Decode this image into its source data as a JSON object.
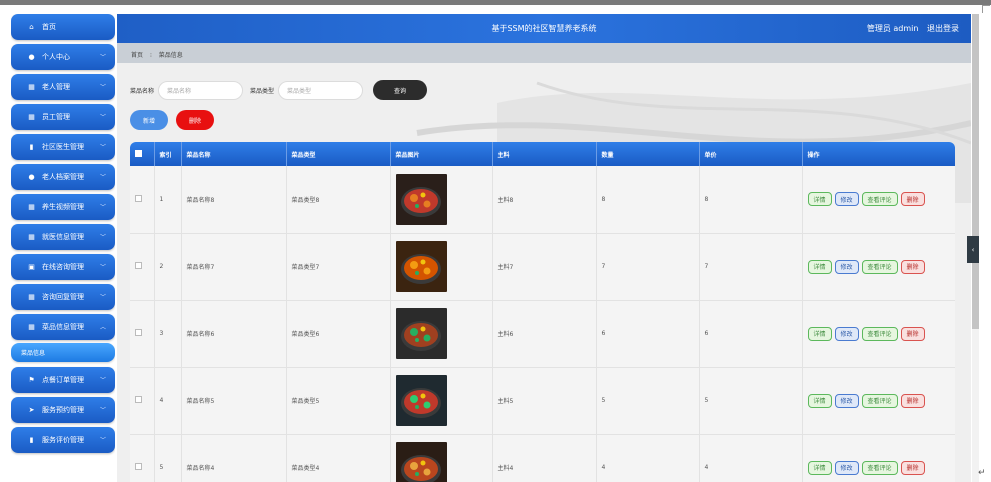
{
  "app": {
    "title": "基于SSM的社区智慧养老系统",
    "user_label": "管理员 admin",
    "logout_label": "退出登录"
  },
  "sidebar": {
    "items": [
      {
        "label": "首页",
        "icon": "home-icon",
        "glyph": "⌂",
        "has_chevron": false
      },
      {
        "label": "个人中心",
        "icon": "user-icon",
        "glyph": "●",
        "has_chevron": true
      },
      {
        "label": "老人管理",
        "icon": "grid-icon",
        "glyph": "▦",
        "has_chevron": true
      },
      {
        "label": "员工管理",
        "icon": "grid-icon",
        "glyph": "▦",
        "has_chevron": true
      },
      {
        "label": "社区医生管理",
        "icon": "chart-icon",
        "glyph": "▮",
        "has_chevron": true
      },
      {
        "label": "老人档案管理",
        "icon": "user-icon",
        "glyph": "●",
        "has_chevron": true
      },
      {
        "label": "养生视频管理",
        "icon": "grid-icon",
        "glyph": "▦",
        "has_chevron": true
      },
      {
        "label": "就医信息管理",
        "icon": "grid-icon",
        "glyph": "▦",
        "has_chevron": true
      },
      {
        "label": "在线咨询管理",
        "icon": "clipboard-icon",
        "glyph": "▣",
        "has_chevron": true
      },
      {
        "label": "咨询回复管理",
        "icon": "grid-icon",
        "glyph": "▦",
        "has_chevron": true
      },
      {
        "label": "菜品信息管理",
        "icon": "grid-icon",
        "glyph": "▦",
        "has_chevron": true,
        "expanded": true
      },
      {
        "label": "点餐订单管理",
        "icon": "flag-icon",
        "glyph": "⚑",
        "has_chevron": true
      },
      {
        "label": "服务预约管理",
        "icon": "send-icon",
        "glyph": "➤",
        "has_chevron": true
      },
      {
        "label": "服务评价管理",
        "icon": "bar-chart-icon",
        "glyph": "▮",
        "has_chevron": true
      }
    ],
    "active_sub_item": "菜品信息"
  },
  "breadcrumb": {
    "home": "首页",
    "separator": "⁝",
    "current": "菜品信息"
  },
  "search": {
    "name_label": "菜品名称",
    "name_placeholder": "菜品名称",
    "type_label": "菜品类型",
    "type_placeholder": "菜品类型",
    "query_button": "查询"
  },
  "actions": {
    "add_button": "新增",
    "delete_button": "删除"
  },
  "table": {
    "columns": [
      "索引",
      "菜品名称",
      "菜品类型",
      "菜品图片",
      "主料",
      "数量",
      "单价",
      "操作"
    ],
    "rows": [
      {
        "index": "1",
        "name": "菜品名称8",
        "type": "菜品类型8",
        "ingredient": "主料8",
        "qty": "8",
        "price": "8"
      },
      {
        "index": "2",
        "name": "菜品名称7",
        "type": "菜品类型7",
        "ingredient": "主料7",
        "qty": "7",
        "price": "7"
      },
      {
        "index": "3",
        "name": "菜品名称6",
        "type": "菜品类型6",
        "ingredient": "主料6",
        "qty": "6",
        "price": "6"
      },
      {
        "index": "4",
        "name": "菜品名称5",
        "type": "菜品类型5",
        "ingredient": "主料5",
        "qty": "5",
        "price": "5"
      },
      {
        "index": "5",
        "name": "菜品名称4",
        "type": "菜品类型4",
        "ingredient": "主料4",
        "qty": "4",
        "price": "4"
      }
    ],
    "row_actions": {
      "detail": "详情",
      "edit": "修改",
      "review": "查看评论",
      "delete": "删除"
    }
  },
  "toggle_glyph": "‹",
  "return_glyph": "↵"
}
